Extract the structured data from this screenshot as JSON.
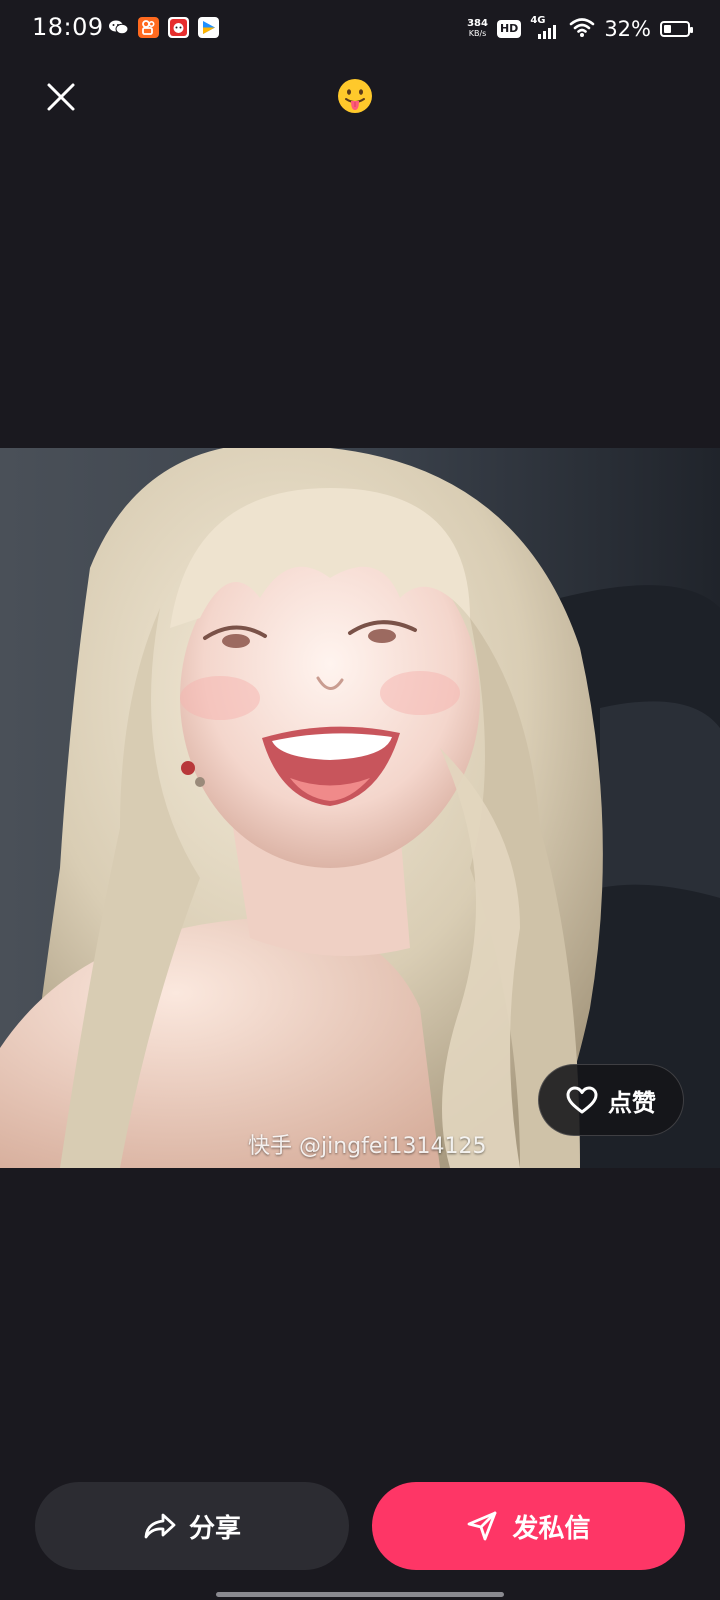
{
  "status_bar": {
    "time": "18:09",
    "net_speed_value": "384",
    "net_speed_unit": "KB/s",
    "hd_badge": "HD",
    "network": "4G",
    "battery_percent": "32%",
    "battery_level": 0.32,
    "notification_icons": [
      "wechat-icon",
      "kuaishou-icon",
      "app-icon",
      "video-app-icon"
    ]
  },
  "top_bar": {
    "emoji": "😛"
  },
  "photo": {
    "watermark": "快手 @jingfei1314125",
    "like_label": "点赞"
  },
  "actions": {
    "share_label": "分享",
    "dm_label": "发私信"
  },
  "colors": {
    "background": "#1a191f",
    "share_button": "#2c2c32",
    "dm_button": "#fe3666"
  }
}
